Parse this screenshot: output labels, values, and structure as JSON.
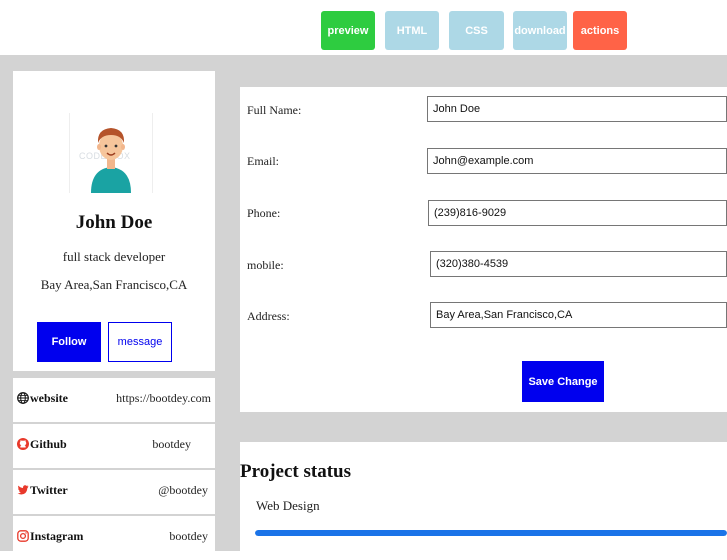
{
  "toolbar": {
    "preview": "preview",
    "html": "HTML",
    "css": "CSS",
    "download": "download",
    "actions": "actions"
  },
  "profile": {
    "avatar_watermark": "CODE BOX",
    "name": "John Doe",
    "title": "full stack developer",
    "location": "Bay Area,San Francisco,CA",
    "follow_label": "Follow",
    "message_label": "message"
  },
  "social": {
    "website": {
      "label": "website",
      "value": "https://bootdey.com",
      "icon": "globe-icon"
    },
    "github": {
      "label": "Github",
      "value": "bootdey",
      "icon": "github-icon"
    },
    "twitter": {
      "label": "Twitter",
      "value": "@bootdey",
      "icon": "twitter-icon"
    },
    "instagram": {
      "label": "Instagram",
      "value": "bootdey",
      "icon": "instagram-icon"
    }
  },
  "form": {
    "full_name": {
      "label": "Full Name:",
      "value": "John Doe"
    },
    "email": {
      "label": "Email:",
      "value": "John@example.com"
    },
    "phone": {
      "label": "Phone:",
      "value": "(239)816-9029"
    },
    "mobile": {
      "label": "mobile:",
      "value": "(320)380-4539"
    },
    "address": {
      "label": "Address:",
      "value": "Bay Area,San Francisco,CA"
    },
    "save_label": "Save Change"
  },
  "project": {
    "title": "Project status",
    "items": [
      {
        "name": "Web Design",
        "progress": 1.0
      }
    ]
  },
  "colors": {
    "preview": "#2ecc40",
    "toolbar_inactive": "#add8e6",
    "actions": "#ff6347",
    "primary": "#0000ee",
    "progress": "#1a73e8",
    "page_bg": "#d3d3d3"
  }
}
